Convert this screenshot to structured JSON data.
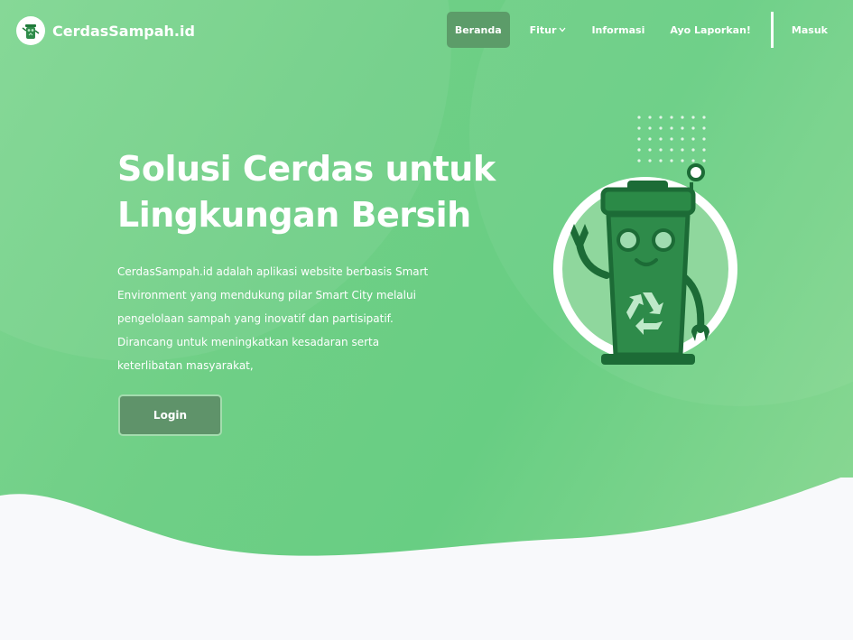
{
  "brand": {
    "name": "CerdasSampah.id",
    "logo_icon": "robot-trash-bin-icon"
  },
  "nav": {
    "items": [
      {
        "label": "Beranda",
        "active": true
      },
      {
        "label": "Fitur",
        "has_dropdown": true
      },
      {
        "label": "Informasi"
      },
      {
        "label": "Ayo Laporkan!"
      },
      {
        "label": "Masuk"
      }
    ]
  },
  "hero": {
    "title_line1": "Solusi Cerdas untuk",
    "title_line2": "Lingkungan Bersih",
    "description": "CerdasSampah.id adalah aplikasi website berbasis Smart Environment yang mendukung pilar Smart City melalui pengelolaan sampah yang inovatif dan partisipatif. Dirancang untuk meningkatkan kesadaran serta keterlibatan masyarakat,",
    "login_label": "Login",
    "illustration_icon": "recycle-robot-bin-icon"
  },
  "colors": {
    "hero_green": "#6fcf86",
    "active_nav": "#5c9c69",
    "button": "#5f936a",
    "bin_dark": "#166b33",
    "bin": "#2e8b4a",
    "background": "#f8f9fb"
  }
}
